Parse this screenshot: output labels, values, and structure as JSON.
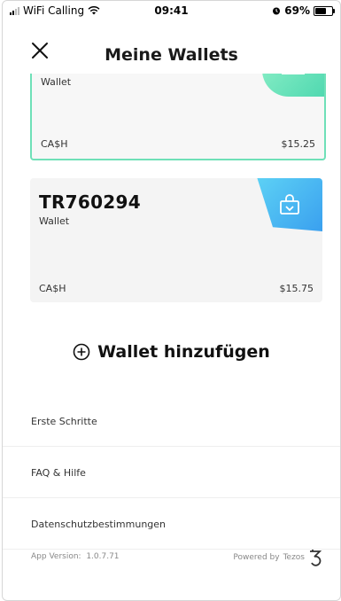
{
  "status_bar": {
    "carrier": "WiFi Calling",
    "time": "09:41",
    "battery": "69%",
    "battery_level": 0.69
  },
  "header": {
    "title": "Meine Wallets"
  },
  "wallets": [
    {
      "subtitle": "Wallet",
      "currency": "CA$H",
      "balance": "$15.25",
      "selected": true,
      "accent_color": "#5fdcb4"
    },
    {
      "name": "TR760294",
      "subtitle": "Wallet",
      "currency": "CA$H",
      "balance": "$15.75",
      "selected": false,
      "accent_color": "#45b3f2"
    }
  ],
  "actions": {
    "add_wallet": "Wallet hinzufügen"
  },
  "menu": {
    "items": [
      {
        "label": "Erste Schritte"
      },
      {
        "label": "FAQ & Hilfe"
      },
      {
        "label": "Datenschutzbestimmungen"
      }
    ]
  },
  "footer": {
    "version_label": "App Version:",
    "version": "1.0.7.71",
    "powered_by": "Powered by",
    "brand": "Tezos"
  },
  "icons": {
    "close": "close-icon",
    "wallet": "wallet-bag-icon",
    "add": "plus-circle-icon",
    "tezos": "tezos-logo-icon"
  }
}
